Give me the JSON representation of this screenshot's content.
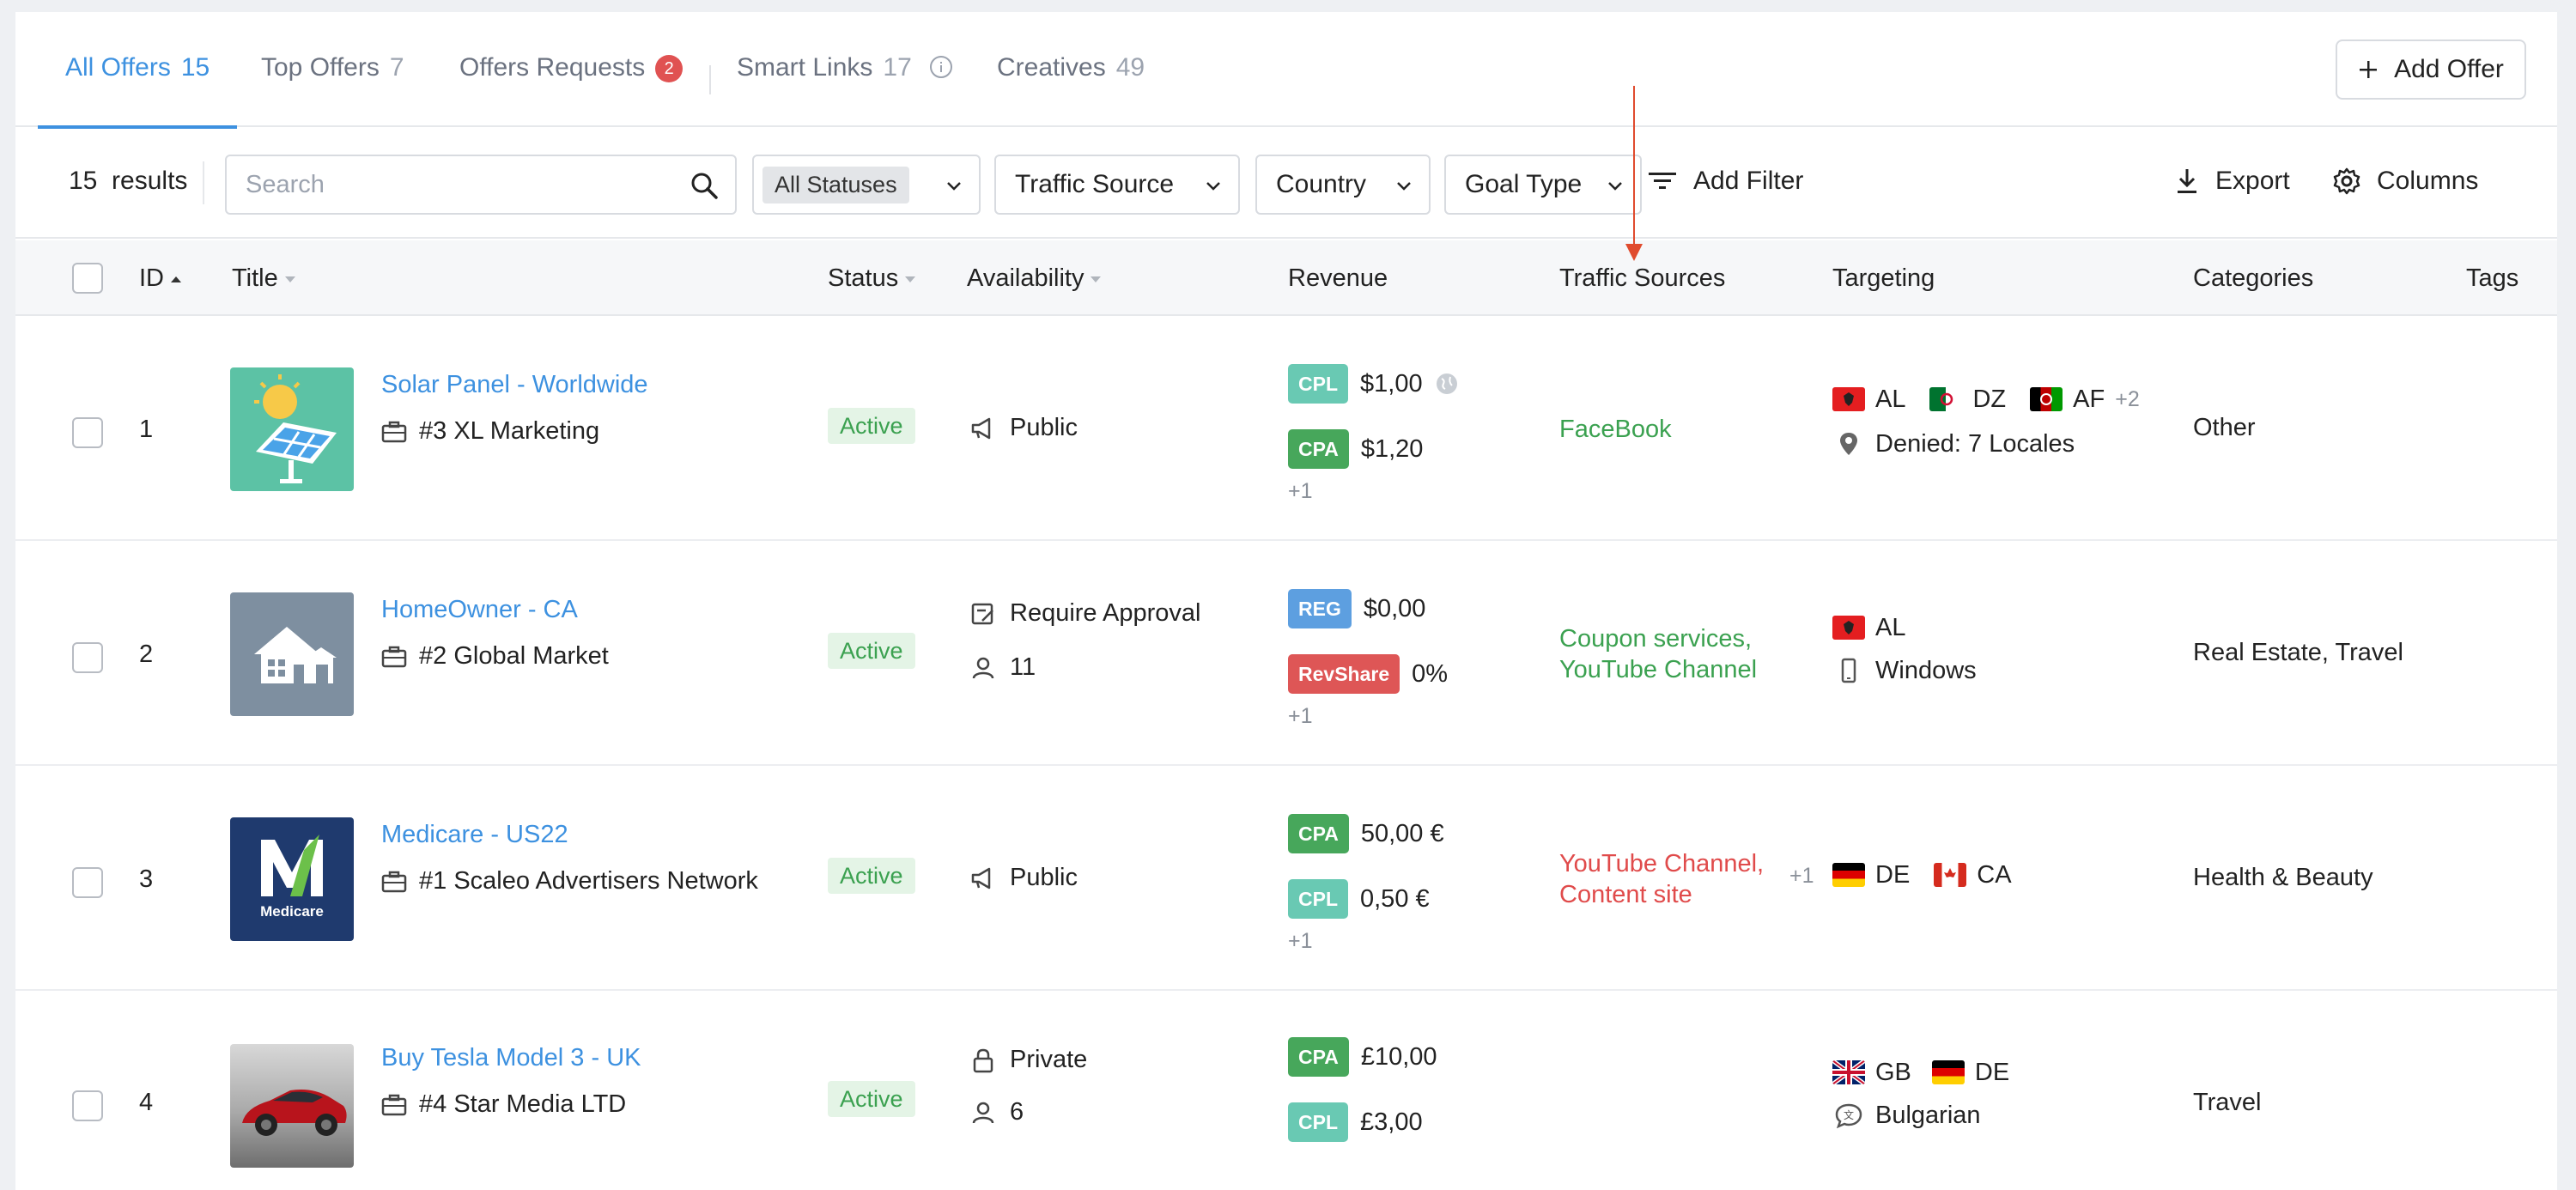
{
  "tabs": [
    {
      "label": "All Offers",
      "count": "15"
    },
    {
      "label": "Top Offers",
      "count": "7"
    },
    {
      "label": "Offers Requests",
      "badge": "2"
    },
    {
      "label": "Smart Links",
      "count": "17"
    },
    {
      "label": "Creatives",
      "count": "49"
    }
  ],
  "add_offer_label": "Add Offer",
  "filters": {
    "results_count": "15",
    "results_label": "results",
    "search_placeholder": "Search",
    "statuses_value": "All Statuses",
    "traffic_source": "Traffic Source",
    "country": "Country",
    "goal_type": "Goal Type",
    "add_filter": "Add Filter",
    "export": "Export",
    "columns": "Columns"
  },
  "columns": {
    "id": "ID",
    "title": "Title",
    "status": "Status",
    "availability": "Availability",
    "revenue": "Revenue",
    "traffic_sources": "Traffic Sources",
    "targeting": "Targeting",
    "categories": "Categories",
    "tags": "Tags"
  },
  "rows": [
    {
      "id": "1",
      "title": "Solar Panel - Worldwide",
      "advertiser": "#3 XL Marketing",
      "status": "Active",
      "availability": "Public",
      "revenue": [
        {
          "type": "CPL",
          "value": "$1,00"
        },
        {
          "type": "CPA",
          "value": "$1,20"
        }
      ],
      "revenue_more": "+1",
      "traffic_sources": "FaceBook",
      "targeting_countries": [
        "AL",
        "DZ",
        "AF"
      ],
      "targeting_more": "+2",
      "targeting_extra": "Denied: 7 Locales",
      "categories": "Other"
    },
    {
      "id": "2",
      "title": "HomeOwner - CA",
      "advertiser": "#2 Global Market",
      "status": "Active",
      "availability": "Require Approval",
      "availability_count": "11",
      "revenue": [
        {
          "type": "REG",
          "value": "$0,00"
        },
        {
          "type": "RevShare",
          "value": "0%"
        }
      ],
      "revenue_more": "+1",
      "traffic_sources_1": "Coupon services,",
      "traffic_sources_2": "YouTube Channel",
      "targeting_countries": [
        "AL"
      ],
      "targeting_extra": "Windows",
      "categories": "Real Estate,  Travel"
    },
    {
      "id": "3",
      "title": "Medicare - US22",
      "advertiser": "#1 Scaleo Advertisers Network",
      "logo_text": "Medicare",
      "status": "Active",
      "availability": "Public",
      "revenue": [
        {
          "type": "CPA",
          "value": "50,00 €"
        },
        {
          "type": "CPL",
          "value": "0,50 €"
        }
      ],
      "revenue_more": "+1",
      "traffic_sources_1": "YouTube Channel,",
      "traffic_sources_2": "Content site",
      "traffic_sources_more": "+1",
      "targeting_countries": [
        "DE",
        "CA"
      ],
      "categories": "Health & Beauty"
    },
    {
      "id": "4",
      "title": "Buy Tesla Model 3 - UK",
      "advertiser": "#4 Star Media LTD",
      "status": "Active",
      "availability": "Private",
      "availability_count": "6",
      "revenue": [
        {
          "type": "CPA",
          "value": "£10,00"
        },
        {
          "type": "CPL",
          "value": "£3,00"
        }
      ],
      "targeting_countries": [
        "GB",
        "DE"
      ],
      "targeting_extra": "Bulgarian",
      "categories": "Travel"
    }
  ],
  "colors": {
    "accent": "#3d91e0",
    "active_green": "#3ba150",
    "danger_red": "#e04b4b",
    "cpl": "#69c9b3",
    "cpa": "#47a75b",
    "reg": "#5d9fe0",
    "revshare": "#de5656"
  },
  "icons": [
    "info-icon",
    "plus-icon",
    "search-icon",
    "chevron-down-icon",
    "filter-icon",
    "download-icon",
    "gear-icon",
    "briefcase-icon",
    "megaphone-icon",
    "approval-icon",
    "user-icon",
    "lock-icon",
    "globe-icon",
    "location-pin-icon",
    "mobile-icon",
    "language-icon"
  ]
}
